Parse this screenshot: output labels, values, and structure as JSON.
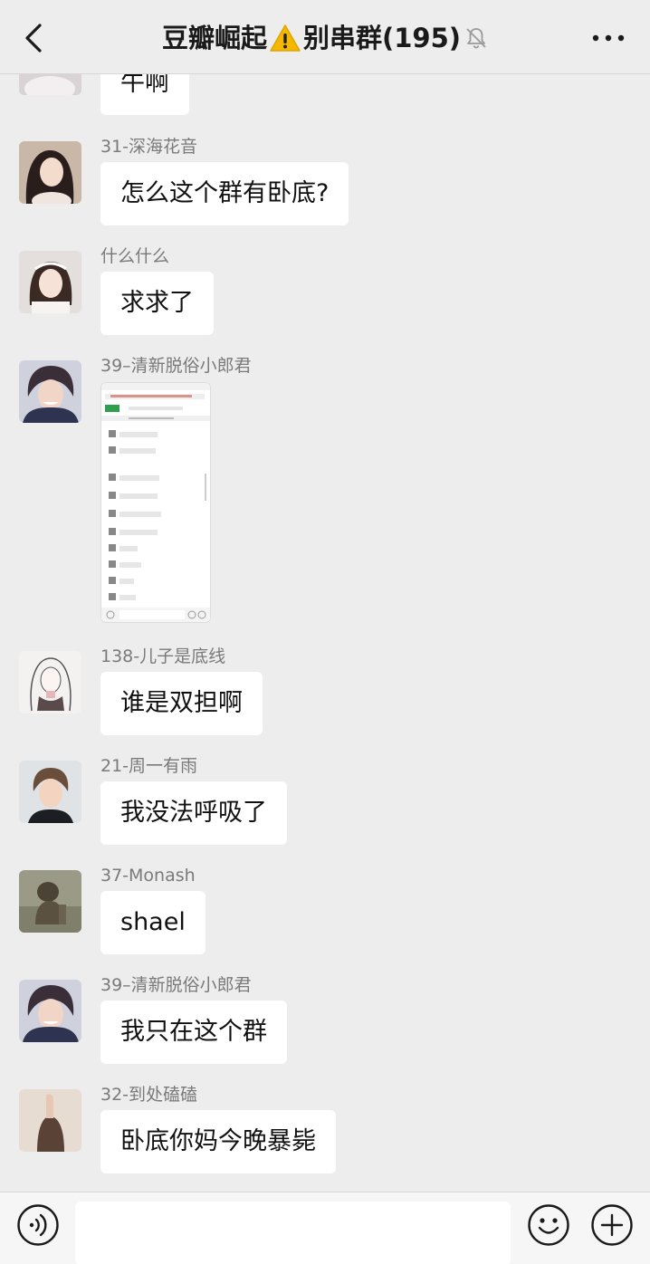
{
  "header": {
    "title_part1": "豆瓣崛起",
    "title_part2": "别串群",
    "member_count": "(195)"
  },
  "messages": [
    {
      "sender": "",
      "text": "牛啊"
    },
    {
      "sender": "31-深海花音",
      "text": "怎么这个群有卧底?"
    },
    {
      "sender": "什么什么",
      "text": "求求了"
    },
    {
      "sender": "39–清新脱俗小郎君",
      "image_title": "豆瓣崛起 ⚠ 别串群(195)"
    },
    {
      "sender": "138-儿子是底线",
      "text": "谁是双担啊"
    },
    {
      "sender": "21-周一有雨",
      "text": "我没法呼吸了"
    },
    {
      "sender": "37-Monash",
      "text": "shael"
    },
    {
      "sender": "39–清新脱俗小郎君",
      "text": "我只在这个群"
    },
    {
      "sender": "32-到处磕磕",
      "text": "卧底你妈今晚暴毙"
    }
  ],
  "input": {
    "value": "",
    "placeholder": ""
  },
  "icons": {
    "back": "chevron-left-icon",
    "warning": "warning-icon",
    "mute": "bell-off-icon",
    "more": "more-icon",
    "voice": "voice-icon",
    "emoji": "emoji-icon",
    "plus": "plus-icon"
  },
  "colors": {
    "background": "#ededed",
    "bubble": "#ffffff",
    "warning": "#f5b800"
  }
}
